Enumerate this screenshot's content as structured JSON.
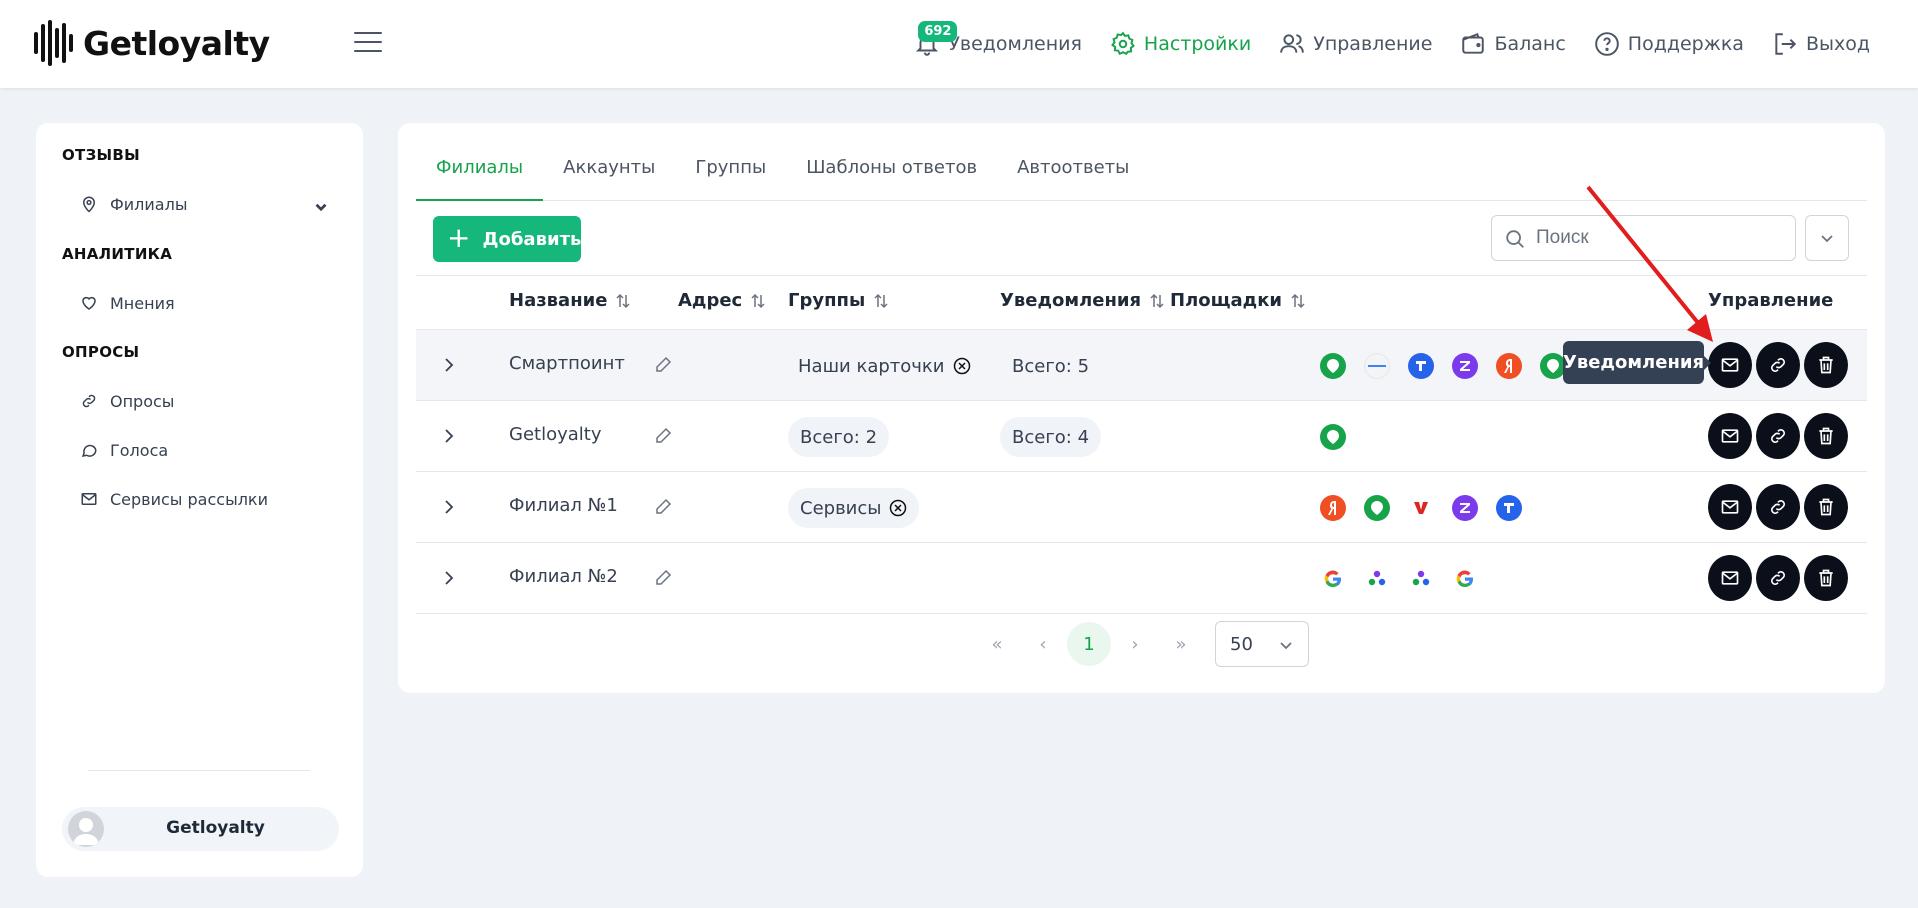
{
  "app": {
    "logo": "Getloyalty"
  },
  "nav": {
    "notifications_badge": "692",
    "notifications": "Уведомления",
    "settings": "Настройки",
    "management": "Управление",
    "balance": "Баланс",
    "support": "Поддержка",
    "logout": "Выход"
  },
  "sidebar": {
    "section_reviews": "ОТЗЫВЫ",
    "branches": "Филиалы",
    "section_analytics": "АНАЛИТИКА",
    "opinions": "Мнения",
    "section_surveys": "ОПРОСЫ",
    "surveys": "Опросы",
    "votes": "Голоса",
    "mailing": "Сервисы рассылки",
    "user": "Getloyalty"
  },
  "tabs": [
    "Филиалы",
    "Аккаунты",
    "Группы",
    "Шаблоны ответов",
    "Автоответы"
  ],
  "toolbar": {
    "add_label": "Добавить",
    "search_placeholder": "Поиск"
  },
  "table": {
    "headers": {
      "name": "Название",
      "address": "Адрес",
      "groups": "Группы",
      "notifications": "Уведомления",
      "platforms": "Площадки",
      "management": "Управление"
    },
    "rows": [
      {
        "name": "Смартпоинт",
        "groups": "Наши карточки",
        "notifications": "Всего: 5"
      },
      {
        "name": "Getloyalty",
        "groups": "Всего: 2",
        "notifications": "Всего: 4"
      },
      {
        "name": "Филиал №1",
        "groups": "Сервисы",
        "notifications": ""
      },
      {
        "name": "Филиал №2",
        "groups": "",
        "notifications": ""
      }
    ]
  },
  "tooltip": "Уведомления",
  "pager": {
    "first": "«",
    "prev": "‹",
    "current": "1",
    "next": "›",
    "last": "»",
    "per_page": "50"
  },
  "colors": {
    "accent": "#16b77a",
    "active_text": "#16a34a",
    "action_bg": "#0b0f1a",
    "tooltip_bg": "#344054",
    "arrow": "#e11d1d"
  }
}
